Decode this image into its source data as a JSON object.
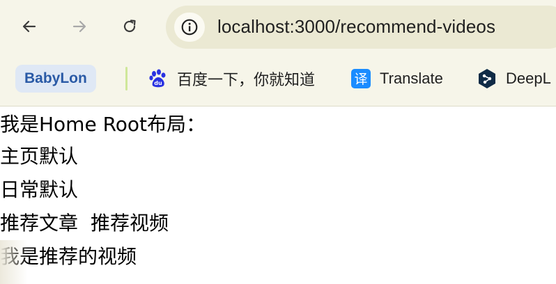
{
  "browser": {
    "address_bar": {
      "url": "localhost:3000/recommend-videos"
    },
    "icons": {
      "back": "arrow-left-icon",
      "forward": "arrow-right-icon",
      "reload": "reload-icon",
      "site_info": "info-circle-icon"
    },
    "bookmarks": [
      {
        "label": "BabyLon"
      },
      {
        "label": "百度一下，你就知道",
        "icon": "baidu-paw-icon"
      },
      {
        "label": "Translate",
        "icon": "translate-icon",
        "icon_text": "译"
      },
      {
        "label": "DeepL",
        "icon": "deepl-icon"
      }
    ]
  },
  "page": {
    "line1": "我是Home Root布局：",
    "line2": "主页默认",
    "line3": "日常默认",
    "nav_links": [
      "推荐文章",
      "推荐视频"
    ],
    "line5": "我是推荐的视频"
  },
  "colors": {
    "toolbar_bg": "#f6f5e9",
    "omnibox_bg": "#ebe9d3",
    "chip_bg": "#dfe8f5",
    "chip_text": "#2a5aa6",
    "translate_blue": "#1a8cff",
    "baidu_blue": "#2932e1"
  }
}
